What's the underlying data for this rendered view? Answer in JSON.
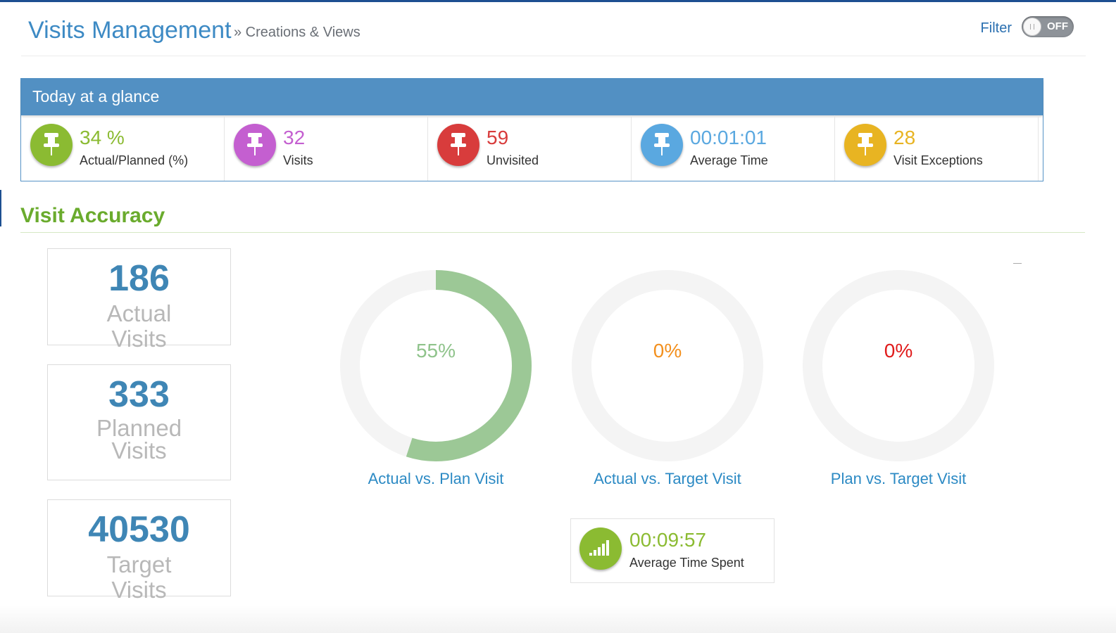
{
  "header": {
    "title": "Visits Management",
    "breadcrumb": "» Creations & Views",
    "filter_label": "Filter",
    "filter_toggle": "OFF"
  },
  "glance": {
    "title": "Today at a glance",
    "stats": [
      {
        "value": "34 %",
        "label": "Actual/Planned (%)",
        "color": "#8bbb32",
        "icon": "pushpin-icon"
      },
      {
        "value": "32",
        "label": "Visits",
        "color": "#c45fd0",
        "icon": "pushpin-icon"
      },
      {
        "value": "59",
        "label": "Unvisited",
        "color": "#d83c3c",
        "icon": "pushpin-icon"
      },
      {
        "value": "00:01:01",
        "label": "Average Time",
        "color": "#5aa8e0",
        "icon": "pushpin-icon"
      },
      {
        "value": "28",
        "label": "Visit Exceptions",
        "color": "#e8b422",
        "icon": "pushpin-icon"
      }
    ]
  },
  "accuracy": {
    "title": "Visit Accuracy",
    "kpis": [
      {
        "value": "186",
        "label": "Actual Visits"
      },
      {
        "value": "333",
        "label": "Planned Visits"
      },
      {
        "value": "40530",
        "label": "Target Visits"
      }
    ],
    "donuts": [
      {
        "percent_text": "55%",
        "value": 55,
        "caption": "Actual vs. Plan Visit",
        "text_color": "#8fc38b",
        "arc_color": "#9cc896"
      },
      {
        "percent_text": "0%",
        "value": 0,
        "caption": "Actual vs. Target Visit",
        "text_color": "#f3901e",
        "arc_color": "#f3901e"
      },
      {
        "percent_text": "0%",
        "value": 0,
        "caption": "Plan vs. Target Visit",
        "text_color": "#e01b1b",
        "arc_color": "#e01b1b"
      }
    ],
    "avg_time_spent": {
      "value": "00:09:57",
      "label": "Average Time Spent",
      "icon": "signal-bars-icon"
    }
  }
}
